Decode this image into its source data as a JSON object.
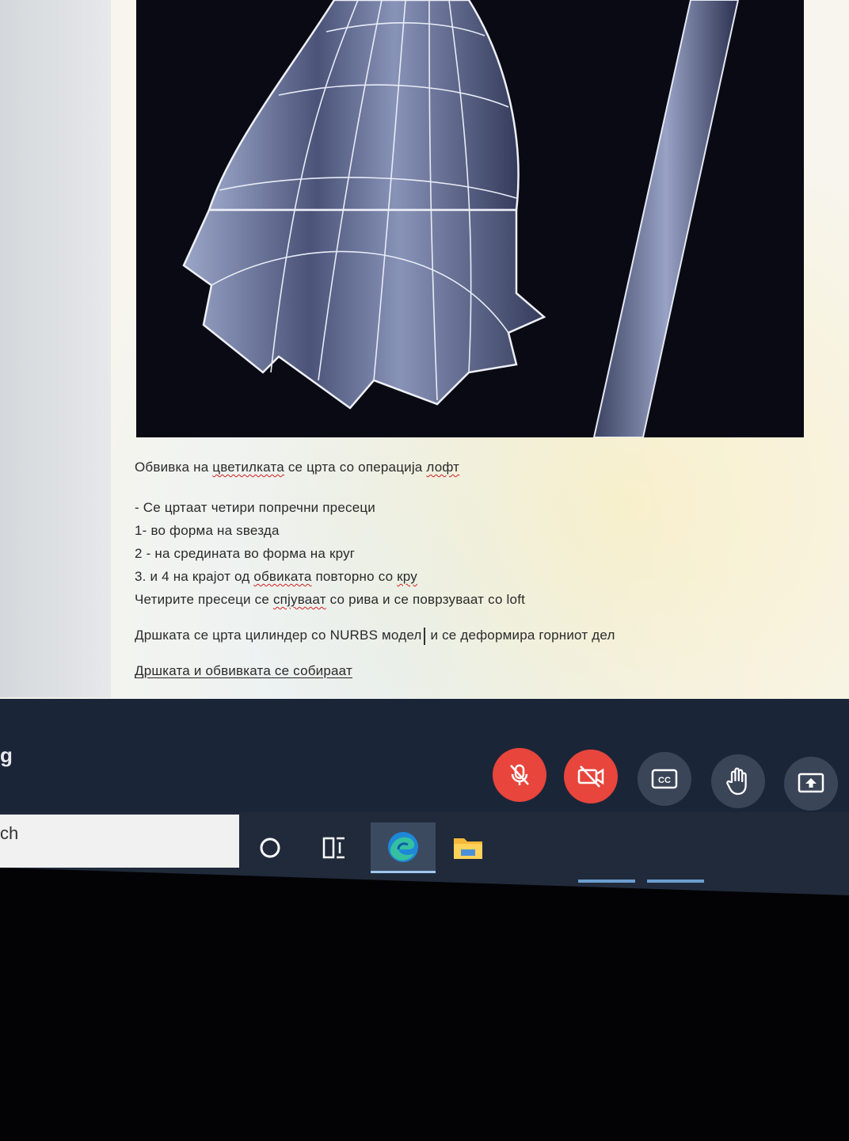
{
  "document": {
    "lines": [
      {
        "parts": [
          "Обвивка на ",
          "цветилката",
          " се црта со операција ",
          "лофт"
        ]
      },
      {
        "text": "- Се цртаат четири попречни пресеци"
      },
      {
        "text": "1- во форма на ѕвезда"
      },
      {
        "text": "2 - на средината во форма на круг"
      },
      {
        "parts": [
          "3. и 4 на крајот од ",
          "обвиката",
          " повторно со ",
          "кру"
        ]
      },
      {
        "parts": [
          "Четирите пресеци се ",
          "спјуваат",
          " со рива и се поврзуваат со loft"
        ]
      },
      {
        "parts": [
          "Дршката се црта цилиндер со NURBS моде",
          "л",
          " и се деформира горниот дел"
        ]
      },
      {
        "text": "Дршката и обвивката се собираат"
      }
    ]
  },
  "meeting": {
    "title_fragment": "g",
    "buttons": [
      {
        "name": "mic-off-button",
        "icon": "mic-off-icon",
        "color": "#e8453c"
      },
      {
        "name": "camera-off-button",
        "icon": "camera-off-icon",
        "color": "#e8453c"
      },
      {
        "name": "captions-button",
        "icon": "cc-icon",
        "color": "#3b4558"
      },
      {
        "name": "raise-hand-button",
        "icon": "hand-icon",
        "color": "#3b4558"
      },
      {
        "name": "present-button",
        "icon": "present-screen-icon",
        "color": "#3b4558"
      }
    ],
    "captions_label": "CC"
  },
  "taskbar": {
    "search_fragment": "ch",
    "icons": [
      "cortana-circle-icon",
      "task-view-icon",
      "edge-icon",
      "file-explorer-icon"
    ]
  }
}
